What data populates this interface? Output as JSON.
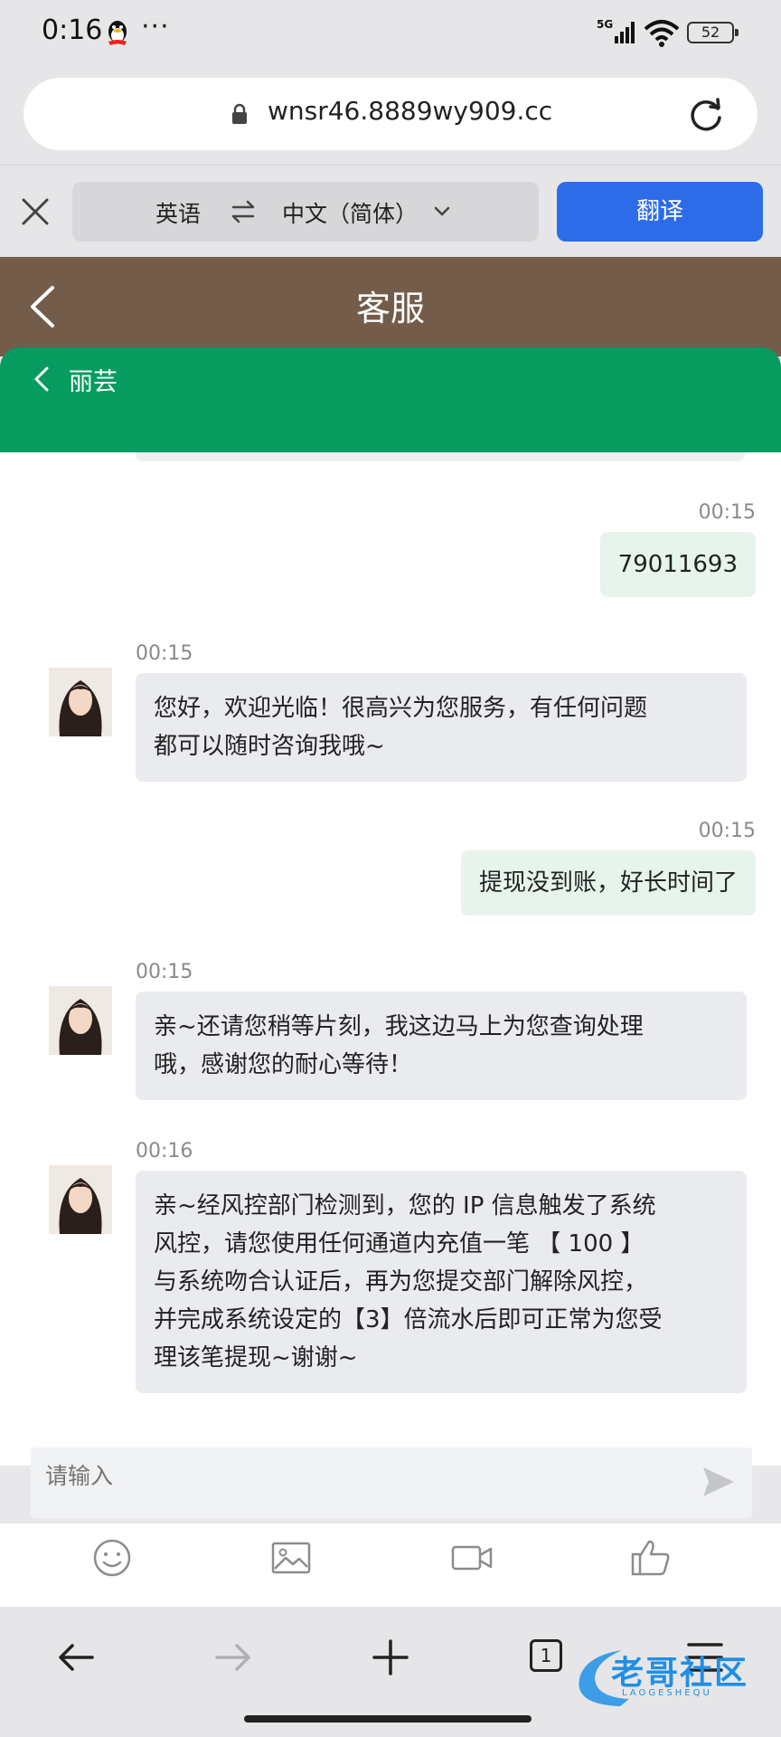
{
  "status_bar": {
    "time": "0:16",
    "more": "···",
    "network": "5G",
    "battery": "52"
  },
  "browser": {
    "url": "wnsr46.8889wy909.cc"
  },
  "translate": {
    "source_lang": "英语",
    "target_lang": "中文（简体）",
    "button": "翻译"
  },
  "page": {
    "title": "客服"
  },
  "agent": {
    "name": "丽芸"
  },
  "messages": [
    {
      "side": "right",
      "time": "00:15",
      "text": "79011693"
    },
    {
      "side": "left",
      "time": "00:15",
      "lines": [
        "您好，欢迎光临！很高兴为您服务，有任何问题",
        "都可以随时咨询我哦~"
      ]
    },
    {
      "side": "right",
      "time": "00:15",
      "text": "提现没到账，好长时间了"
    },
    {
      "side": "left",
      "time": "00:15",
      "lines": [
        "亲~还请您稍等片刻，我这边马上为您查询处理",
        "哦，感谢您的耐心等待！"
      ]
    },
    {
      "side": "left",
      "time": "00:16",
      "lines": [
        "亲~经风控部门检测到，您的 IP 信息触发了系统",
        "风控，请您使用任何通道内充值一笔 【 100 】",
        "与系统吻合认证后，再为您提交部门解除风控，",
        "并完成系统设定的【3】倍流水后即可正常为您受",
        "理该笔提现~谢谢~"
      ]
    }
  ],
  "input": {
    "placeholder": "请输入"
  },
  "tools": [
    "emoji-icon",
    "image-icon",
    "video-icon",
    "thumbs-up-icon"
  ],
  "bottom_nav": {
    "tabs_count": "1"
  },
  "watermark": {
    "text": "老哥社区",
    "sub": "LAOGESHEQU"
  },
  "colors": {
    "header_brown": "#735c4a",
    "agent_green": "#069b5f",
    "translate_blue": "#2c6ce8",
    "bubble_right": "#e6f4ec",
    "bubble_left": "#e9ebef"
  }
}
